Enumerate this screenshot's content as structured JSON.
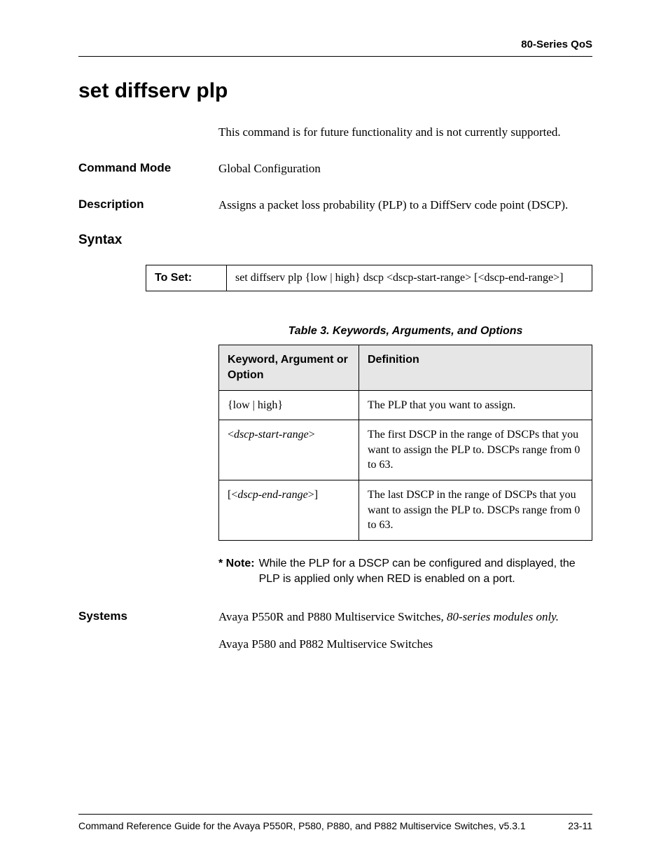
{
  "header": {
    "right": "80-Series QoS"
  },
  "title": "set diffserv plp",
  "intro": "This command is for future functionality and is not currently supported.",
  "sections": {
    "command_mode": {
      "label": "Command Mode",
      "text": "Global Configuration"
    },
    "description": {
      "label": "Description",
      "text": "Assigns a packet loss probability (PLP) to a DiffServ code point (DSCP)."
    },
    "syntax": {
      "label": "Syntax"
    },
    "systems": {
      "label": "Systems",
      "text1_a": "Avaya P550R and P880 Multiservice Switches",
      "text1_b": ", 80-series modules only.",
      "text2": "Avaya P580 and P882 Multiservice Switches"
    }
  },
  "syntax_box": {
    "label": "To Set:",
    "command": "set diffserv plp {low | high} dscp <dscp-start-range> [<dscp-end-range>]"
  },
  "table": {
    "caption": "Table 3.  Keywords, Arguments, and Options",
    "headers": {
      "col1": "Keyword, Argument or Option",
      "col2": "Definition"
    },
    "rows": [
      {
        "kw": "{low | high}",
        "def": "The PLP that you want to assign."
      },
      {
        "kw_open": "<",
        "kw_italic": "dscp-start-range",
        "kw_close": ">",
        "def": "The first DSCP in the range of DSCPs that you want to assign the PLP to. DSCPs range from 0 to 63."
      },
      {
        "kw_open": "[<",
        "kw_italic": "dscp-end-range",
        "kw_close": ">]",
        "def": "The last DSCP in the range of DSCPs that you want to assign the PLP to. DSCPs range from 0 to 63."
      }
    ]
  },
  "note": {
    "prefix": "* Note:",
    "text": "While the PLP for a DSCP can be configured and displayed, the PLP is applied only when RED is enabled on a port."
  },
  "footer": {
    "left": "Command Reference Guide for the Avaya P550R, P580, P880, and P882 Multiservice Switches, v5.3.1",
    "right": "23-11"
  }
}
